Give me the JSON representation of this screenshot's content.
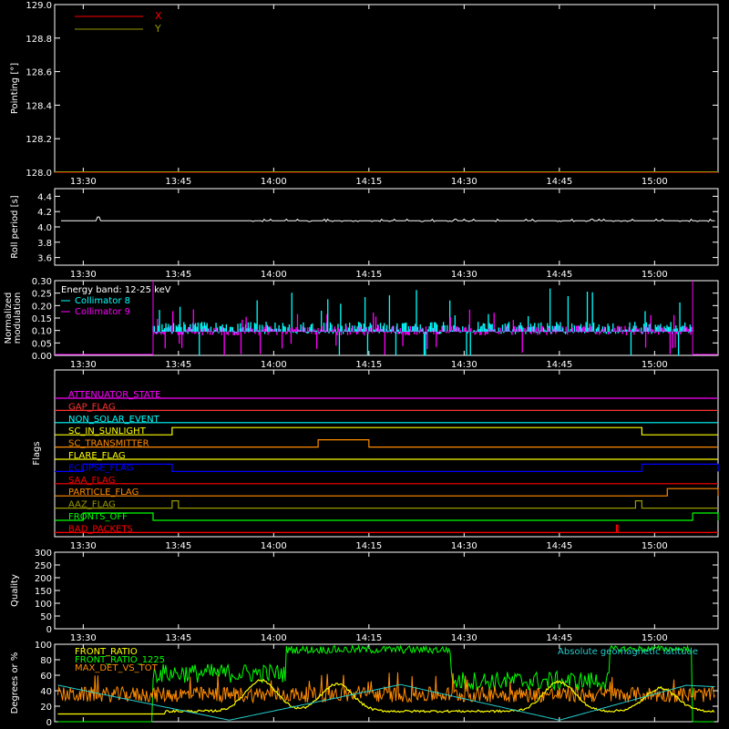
{
  "colors": {
    "bg": "#000000",
    "frame": "#ffffff",
    "x": "#ff0000",
    "y": "#999900",
    "roll": "#ffffff",
    "coll8": "#00ffff",
    "coll9": "#ff00ff",
    "green": "#00ff00",
    "yellow": "#ffff00",
    "orange": "#ff8c00",
    "cyan": "#22cccc"
  },
  "time_ticks": [
    "13:30",
    "13:45",
    "14:00",
    "14:15",
    "14:30",
    "14:45",
    "15:00"
  ],
  "chart_data": [
    {
      "id": "pointing",
      "type": "line",
      "ylabel": "Pointing [°]",
      "ylim": [
        128.0,
        129.0
      ],
      "ytick_labels": [
        "128.0",
        "128.2",
        "128.4",
        "128.6",
        "128.8",
        "129.0"
      ],
      "legend": "top-left",
      "series": [
        {
          "name": "X",
          "color": "#ff0000",
          "x": [
            "13:30",
            "15:10"
          ],
          "y": [
            128.0,
            128.0
          ]
        },
        {
          "name": "Y",
          "color": "#999900",
          "x": [
            "13:30",
            "15:10"
          ],
          "y": [
            128.0,
            128.0
          ]
        }
      ]
    },
    {
      "id": "roll",
      "type": "line",
      "ylabel": "Roll period [s]",
      "ylim": [
        3.5,
        4.5
      ],
      "ytick_labels": [
        "3.6",
        "3.8",
        "4.0",
        "4.2",
        "4.4"
      ],
      "series": [
        {
          "name": "",
          "color": "#ffffff",
          "x": [
            "13:30",
            "13:31",
            "13:32",
            "13:33",
            "13:34",
            "13:45",
            "14:00",
            "14:30",
            "15:00",
            "15:10"
          ],
          "y": [
            4.08,
            4.08,
            4.13,
            4.08,
            4.08,
            4.08,
            4.09,
            4.09,
            4.08,
            4.08
          ]
        }
      ]
    },
    {
      "id": "modulation",
      "type": "bar",
      "ylabel": "Normalized modulation",
      "ylim": [
        0.0,
        0.3
      ],
      "ytick_labels": [
        "0.00",
        "0.05",
        "0.10",
        "0.15",
        "0.20",
        "0.25",
        "0.30"
      ],
      "annotation": "Energy band: 12-25 keV",
      "legend": "top-left",
      "series": [
        {
          "name": "Collimator 8",
          "color": "#00ffff",
          "x_start": "13:41",
          "x_end": "15:06",
          "baseline": 0.1,
          "peak": 0.27
        },
        {
          "name": "Collimator 9",
          "color": "#ff00ff",
          "x_start": "13:41",
          "x_end": "15:06",
          "baseline": 0.1,
          "peak": 0.18
        }
      ]
    },
    {
      "id": "flags",
      "type": "line",
      "ylabel": "Flags",
      "series": [
        {
          "name": "ATTENUATOR_STATE",
          "color": "#ff00ff",
          "high": []
        },
        {
          "name": "GAP_FLAG",
          "color": "#ff3333",
          "high": []
        },
        {
          "name": "NON_SOLAR_EVENT",
          "color": "#00ffff",
          "high": []
        },
        {
          "name": "SC_IN_SUNLIGHT",
          "color": "#ffff00",
          "high": [
            [
              "13:44",
              "14:58"
            ]
          ]
        },
        {
          "name": "SC_TRANSMITTER",
          "color": "#ff8c00",
          "high": [
            [
              "14:07",
              "14:15"
            ]
          ]
        },
        {
          "name": "FLARE_FLAG",
          "color": "#ffff00",
          "high": []
        },
        {
          "name": "ECLIPSE_FLAG",
          "color": "#0000ff",
          "high": [
            [
              "13:30",
              "13:44"
            ],
            [
              "14:58",
              "15:10"
            ]
          ]
        },
        {
          "name": "SAA_FLAG",
          "color": "#ff0000",
          "high": []
        },
        {
          "name": "PARTICLE_FLAG",
          "color": "#ff8c00",
          "high": [
            [
              "15:02",
              "15:10"
            ]
          ]
        },
        {
          "name": "AAZ_FLAG",
          "color": "#999900",
          "high": [
            [
              "13:44",
              "13:45"
            ],
            [
              "14:57",
              "14:58"
            ]
          ]
        },
        {
          "name": "FRONTS_OFF",
          "color": "#00ff00",
          "high": [
            [
              "13:30",
              "13:41"
            ],
            [
              "15:06",
              "15:10"
            ]
          ]
        },
        {
          "name": "BAD_PACKETS",
          "color": "#ff0000",
          "high": [
            [
              "14:54",
              "14:54"
            ]
          ]
        }
      ]
    },
    {
      "id": "quality",
      "type": "line",
      "ylabel": "Quality",
      "ylim": [
        0,
        300
      ],
      "ytick_labels": [
        "0",
        "50",
        "100",
        "150",
        "200",
        "250",
        "300"
      ],
      "series": []
    },
    {
      "id": "ratios",
      "type": "line",
      "ylabel": "Degrees or %",
      "ylim": [
        0,
        100
      ],
      "ytick_labels": [
        "0",
        "20",
        "40",
        "60",
        "80",
        "100"
      ],
      "legend": "top-left",
      "series": [
        {
          "name": "FRONT_RATIO",
          "color": "#ffff00"
        },
        {
          "name": "FRONT_RATIO_1225",
          "color": "#00ff00"
        },
        {
          "name": "MAX_DET_VS_TOT",
          "color": "#ff8c00"
        },
        {
          "name": "Absolute geomagnetic latitude",
          "color": "#22cccc"
        }
      ]
    }
  ]
}
